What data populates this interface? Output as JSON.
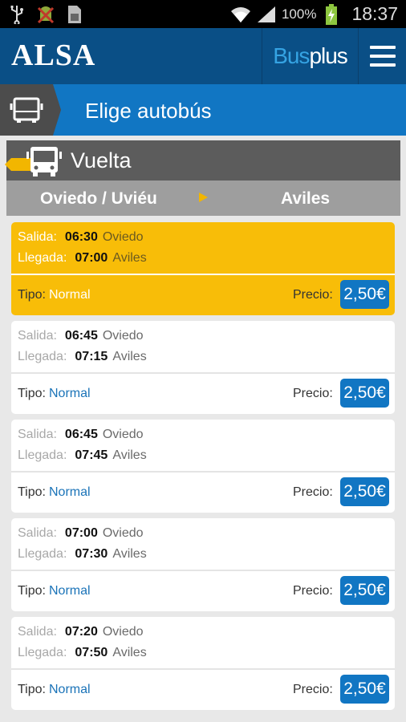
{
  "status_bar": {
    "battery": "100%",
    "time": "18:37",
    "icons": [
      "usb-icon",
      "android-debug-icon",
      "sd-card-icon",
      "wifi-icon",
      "signal-icon",
      "battery-charging-icon"
    ]
  },
  "header": {
    "logo": "ALSA",
    "brand_bus": "Bus",
    "brand_plus": "plus",
    "menu_icon": "hamburger-menu-icon"
  },
  "title_bar": {
    "icon": "bus-icon",
    "title": "Elige autobús"
  },
  "section": {
    "direction": "Vuelta",
    "route_from": "Oviedo / Uviéu",
    "route_to": "Aviles"
  },
  "labels": {
    "departure": "Salida:",
    "arrival": "Llegada:",
    "type": "Tipo:",
    "price": "Precio:"
  },
  "trips": [
    {
      "dep_time": "06:30",
      "dep_place": "Oviedo",
      "arr_time": "07:00",
      "arr_place": "Aviles",
      "type": "Normal",
      "price": "2,50€",
      "selected": true
    },
    {
      "dep_time": "06:45",
      "dep_place": "Oviedo",
      "arr_time": "07:15",
      "arr_place": "Aviles",
      "type": "Normal",
      "price": "2,50€",
      "selected": false
    },
    {
      "dep_time": "06:45",
      "dep_place": "Oviedo",
      "arr_time": "07:45",
      "arr_place": "Aviles",
      "type": "Normal",
      "price": "2,50€",
      "selected": false
    },
    {
      "dep_time": "07:00",
      "dep_place": "Oviedo",
      "arr_time": "07:30",
      "arr_place": "Aviles",
      "type": "Normal",
      "price": "2,50€",
      "selected": false
    },
    {
      "dep_time": "07:20",
      "dep_place": "Oviedo",
      "arr_time": "07:50",
      "arr_place": "Aviles",
      "type": "Normal",
      "price": "2,50€",
      "selected": false
    }
  ],
  "colors": {
    "brand_blue": "#0a4f86",
    "accent_blue": "#1176c3",
    "selected_yellow": "#f8bd08",
    "section_gray": "#5c5c5c",
    "route_gray": "#9e9e9e"
  }
}
